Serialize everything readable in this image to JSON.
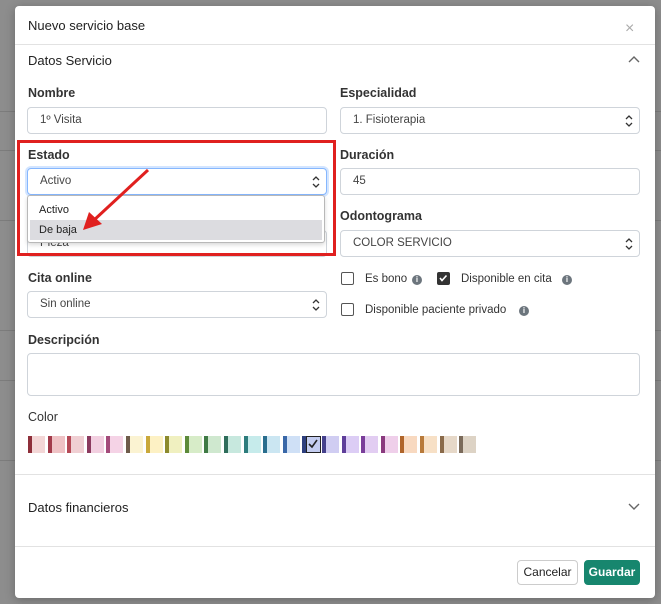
{
  "modal": {
    "title": "Nuevo servicio base",
    "close_glyph": "×"
  },
  "section_datos": {
    "title": "Datos Servicio"
  },
  "fields": {
    "nombre": {
      "label": "Nombre",
      "value": "1º Visita"
    },
    "especialidad": {
      "label": "Especialidad",
      "value": "1. Fisioterapia"
    },
    "estado": {
      "label": "Estado",
      "value": "Activo",
      "options": [
        "Activo",
        "De baja"
      ],
      "highlighted_option": "De baja",
      "behind_dropdown_text": "Pieza"
    },
    "duracion": {
      "label": "Duración",
      "value": "45"
    },
    "odontograma": {
      "label": "Odontograma",
      "value": "COLOR SERVICIO"
    },
    "cita_online": {
      "label": "Cita online",
      "value": "Sin online"
    },
    "descripcion": {
      "label": "Descripción",
      "value": ""
    },
    "color": {
      "label": "Color"
    }
  },
  "checkboxes": {
    "es_bono": {
      "label": "Es bono",
      "checked": false
    },
    "disponible_cita": {
      "label": "Disponible en cita",
      "checked": true
    },
    "disponible_privado": {
      "label": "Disponible paciente privado",
      "checked": false
    }
  },
  "section_financieros": {
    "title": "Datos financieros"
  },
  "buttons": {
    "cancel": "Cancelar",
    "save": "Guardar"
  },
  "colors": {
    "primary": "#17866e",
    "annotation_red": "#e0201f",
    "palette": [
      [
        "#8e2f3a",
        "#f3d6d6"
      ],
      [
        "#a23b4a",
        "#efc2c5"
      ],
      [
        "#b54a57",
        "#f0cfd3"
      ],
      [
        "#8b3a5f",
        "#f2cfe0"
      ],
      [
        "#a34a7a",
        "#f5d3e6"
      ],
      [
        "#6e5b4a",
        "#fbf3d2"
      ],
      [
        "#c9a83a",
        "#fdf1c4"
      ],
      [
        "#8c8a2d",
        "#f0f0c0"
      ],
      [
        "#5c8a3a",
        "#d7ecc8"
      ],
      [
        "#3f7a45",
        "#cfe8cf"
      ],
      [
        "#2f6d5b",
        "#c7e8de"
      ],
      [
        "#2d7c7c",
        "#c6ebeb"
      ],
      [
        "#2a6e8e",
        "#cbe6f2"
      ],
      [
        "#3a68a8",
        "#cfe0f6"
      ],
      [
        "#2e3f7e",
        "#c4cdf0"
      ],
      [
        "#45408c",
        "#d0cdf2"
      ],
      [
        "#5f3f9a",
        "#dccdf5"
      ],
      [
        "#7a3e9a",
        "#e2cdf2"
      ],
      [
        "#8a3a7e",
        "#efcfea"
      ],
      [
        "#b0652a",
        "#f8d9c0"
      ],
      [
        "#b87a3a",
        "#f7e0c6"
      ],
      [
        "#8a6a4a",
        "#e6d8c8"
      ],
      [
        "#7a6a5a",
        "#ddd3c5"
      ]
    ],
    "selected_index": 14
  }
}
